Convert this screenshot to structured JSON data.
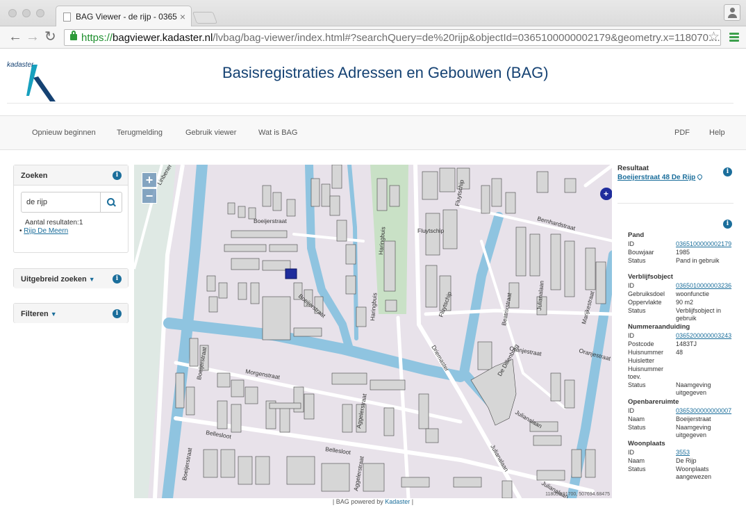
{
  "browser": {
    "tab_title": "BAG Viewer - de rijp - 0365",
    "url_protocol": "https://",
    "url_host": "bagviewer.kadaster.nl",
    "url_path": "/lvbag/bag-viewer/index.html#?searchQuery=de%20rijp&objectId=0365100000002179&geometry.x=118070....",
    "accent_green": "#2e9b3a"
  },
  "header": {
    "logo_text": "kadaster",
    "title": "Basisregistraties Adressen en Gebouwen (BAG)"
  },
  "nav": {
    "left": [
      "Opnieuw beginnen",
      "Terugmelding",
      "Gebruik viewer",
      "Wat is BAG"
    ],
    "right": [
      "PDF",
      "Help"
    ]
  },
  "search_panel": {
    "title": "Zoeken",
    "query": "de rijp",
    "results_label": "Aantal resultaten:1",
    "results": [
      "Rijp De Meern"
    ]
  },
  "advanced_search": {
    "title": "Uitgebreid zoeken"
  },
  "filters": {
    "title": "Filteren"
  },
  "map": {
    "zoom_in": "+",
    "zoom_out": "−",
    "coordinates": "118059.91700, 507694.68475",
    "streets": [
      "Boeijerstraat",
      "Boeijerstraat",
      "Boeijerstraat",
      "Boeijerstraat",
      "Haringbuis",
      "Haringbuis",
      "Fluytschip",
      "Fluytschip",
      "Fluytschip",
      "Bernhardstraat",
      "Beatrixstraat",
      "Julianalaan",
      "Julianalaan",
      "Julianalaan",
      "Julianalaan",
      "Marijkestraat",
      "Oranjestraat",
      "Oranjestraat",
      "De Dillenburg",
      "Driemaster",
      "Morgenstraat",
      "Aggelerstraat",
      "Aggelerstraat",
      "Bellesloot",
      "Bellesloot",
      "Linbener"
    ],
    "colors": {
      "water": "#8fc4e0",
      "park": "#c9e1c6",
      "land": "#e8e2ea",
      "building": "#d6d6d6",
      "road": "#ffffff"
    }
  },
  "footer": {
    "prefix": "| BAG powered by",
    "link": "Kadaster",
    "suffix": "|"
  },
  "result": {
    "title": "Resultaat",
    "address": "Boeijerstraat 48 De Rijp",
    "sections": [
      {
        "name": "Pand",
        "rows": [
          {
            "k": "ID",
            "v": "0365100000002179",
            "link": true
          },
          {
            "k": "Bouwjaar",
            "v": "1985"
          },
          {
            "k": "Status",
            "v": "Pand in gebruik"
          }
        ]
      },
      {
        "name": "Verblijfsobject",
        "rows": [
          {
            "k": "ID",
            "v": "0365010000003236",
            "link": true
          },
          {
            "k": "Gebruiksdoel",
            "v": "woonfunctie"
          },
          {
            "k": "Oppervlakte",
            "v": "90 m2"
          },
          {
            "k": "Status",
            "v": "Verblijfsobject in gebruik"
          }
        ]
      },
      {
        "name": "Nummeraanduiding",
        "rows": [
          {
            "k": "ID",
            "v": "0365200000003243",
            "link": true
          },
          {
            "k": "Postcode",
            "v": "1483TJ"
          },
          {
            "k": "Huisnummer",
            "v": "48"
          },
          {
            "k": "Huisletter",
            "v": ""
          },
          {
            "k": "Huisnummer toev.",
            "v": ""
          },
          {
            "k": "Status",
            "v": "Naamgeving uitgegeven"
          }
        ]
      },
      {
        "name": "Openbareruimte",
        "rows": [
          {
            "k": "ID",
            "v": "0365300000000007",
            "link": true
          },
          {
            "k": "Naam",
            "v": "Boeijerstraat"
          },
          {
            "k": "Status",
            "v": "Naamgeving uitgegeven"
          }
        ]
      },
      {
        "name": "Woonplaats",
        "rows": [
          {
            "k": "ID",
            "v": "3553",
            "link": true
          },
          {
            "k": "Naam",
            "v": "De Rijp"
          },
          {
            "k": "Status",
            "v": "Woonplaats aangewezen"
          }
        ]
      }
    ]
  }
}
